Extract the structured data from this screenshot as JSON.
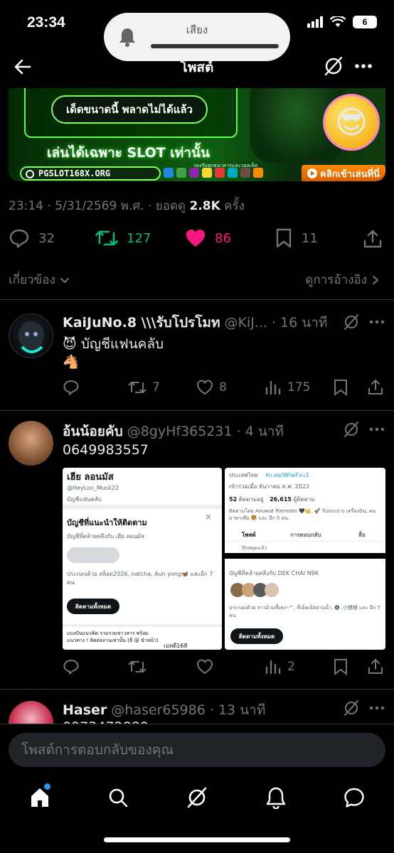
{
  "status": {
    "time": "23:34",
    "battery": "6"
  },
  "sound": {
    "label": "เสียง"
  },
  "nav": {
    "title": "โพสต์"
  },
  "banner": {
    "tagline": "เด็ดขนาดนี้ พลาดไม่ได้แล้ว",
    "slogan": "เล่นได้เฉพาะ SLOT เท่านั้น",
    "url": "PGSLOT168X.ORG",
    "support_text": "รองรับทุกธนาคารและวอลเล็ท",
    "cta": "คลิกเข้าเล่นที่นี่"
  },
  "post_meta": {
    "time": "23:14 · 5/31/2569 พ.ศ. · ยอดดู",
    "views": "2.8K",
    "views_unit": "ครั้ง"
  },
  "stats": {
    "replies": "32",
    "reposts": "127",
    "likes": "86",
    "bookmarks": "11"
  },
  "related": {
    "left": "เกี่ยวข้อง",
    "right": "ดูการอ้างอิง"
  },
  "replies": [
    {
      "name": "KaiJuNo.8 \\\\\\รับโปรโมท",
      "handle": "@KiJ... · 16 นาที",
      "line1": "😈 บัญชีแฟนคลับ",
      "line2": "🐴",
      "actions": {
        "retweets": "7",
        "likes": "8",
        "views": "175"
      }
    },
    {
      "name": "อ้นน้อยคับ",
      "handle": "@8gyHf365231 · 4 นาที",
      "line1": "0649983557",
      "actions": {
        "retweets": "",
        "likes": "",
        "views": "2"
      },
      "shot_left": {
        "name": "เฮีย ลอนมัส",
        "handle": "@HeyLon_Musk22",
        "badge": "บัญชีแฟนคลับ",
        "heading": "บัญชีที่แนะนำให้ติดตาม",
        "subheading": "บัญชีที่คล้ายคลึงกับ เฮีย ลอนมัส",
        "members": "ประกอบด้วย สล็อต2026, natcha, Aun yong🦋 และอีก 7 คน",
        "follow_all": "ติดตามทั้งหมด",
        "footer": "แบงปันแนวคิด รวมรวมข่าวสาร พร้อมแนวทาง ! ติดต่องานเท่านั้น (มี @ นำหน้า)",
        "footer_tag": "เบทดี168"
      },
      "shot_right": {
        "location": "ประเทศไทย",
        "link": "lin.ee/WtwFxu1",
        "joined": "เข้าร่วมเมื่อ ธันวาคม ค.ศ. 2022",
        "following": "52",
        "following_label": "ติดตามอยู่",
        "followers": "26,615",
        "followers_label": "ผู้ติดตาม",
        "followed_by": "ติดตามโดย Anuwat Riemsen 🖤👑, 🚀 รับประยาง เครื่องบิน, คนมาหาเซีย 🐯 และ อีก 5 คน",
        "tabs": [
          "โพสต์",
          "การตอบกลับ",
          "สื่อ"
        ],
        "pinned": "ปักหมุดแล้ว",
        "subheading": "บัญชีที่คล้ายคลึงกับ DEK CHAI N9K",
        "members": "ประกอบด้วย สาวอ้วนชี้เหงา™, ที่เด็ดเจ็ดย่านน้ำ, 🅐 .小猪猪 และ อีก 7 คน",
        "follow_all": "ติดตามทั้งหมด"
      }
    },
    {
      "name": "Haser",
      "handle": "@haser65986 · 13 นาที",
      "line1": "0973472880"
    }
  ],
  "reply_box": {
    "placeholder": "โพสต์การตอบกลับของคุณ"
  },
  "colors": {
    "accent": "#1d9bf0",
    "retweet": "#00ba7c",
    "like": "#f91880",
    "muted": "#71767b"
  }
}
